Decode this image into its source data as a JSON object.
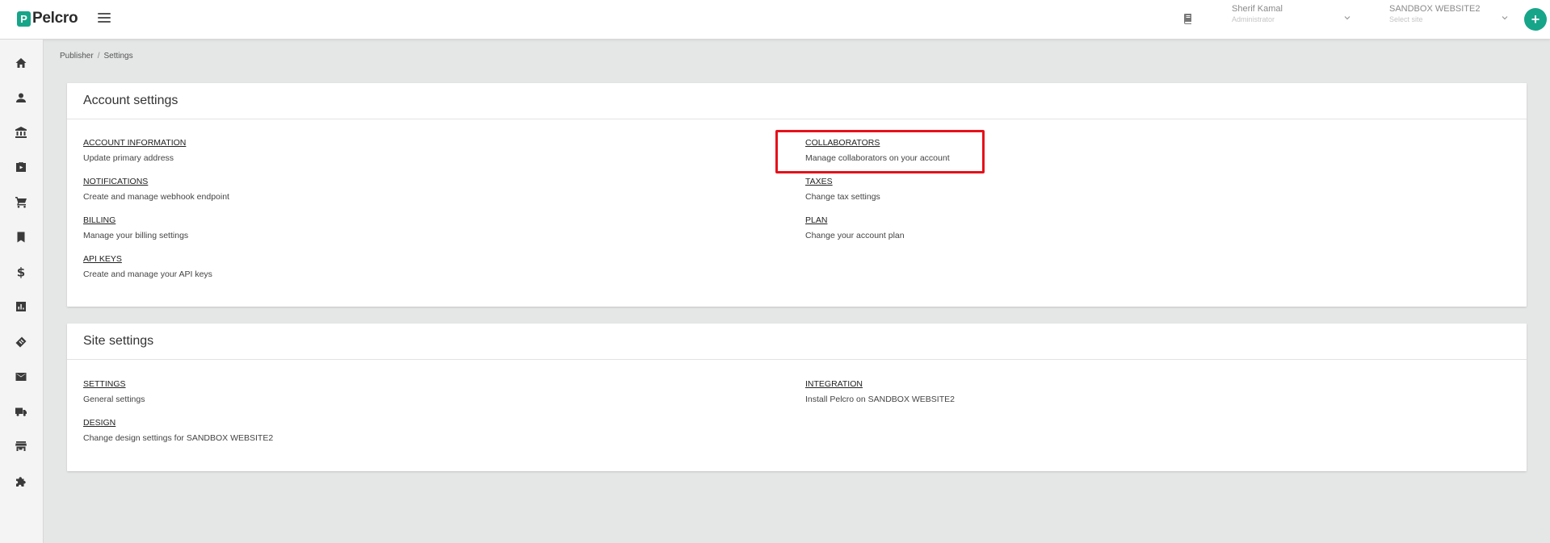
{
  "app": {
    "logo_text": "Pelcro",
    "logo_mark": "P"
  },
  "header": {
    "user_name": "Sherif Kamal",
    "user_role": "Administrator",
    "site_name": "SANDBOX WEBSITE2",
    "site_placeholder": "Select site",
    "add_label": "+"
  },
  "sidebar": {
    "items": [
      {
        "name": "home",
        "icon": "home-icon"
      },
      {
        "name": "customers",
        "icon": "person-icon"
      },
      {
        "name": "bank",
        "icon": "bank-icon"
      },
      {
        "name": "products",
        "icon": "briefcase-icon"
      },
      {
        "name": "orders",
        "icon": "cart-icon"
      },
      {
        "name": "bookmarks",
        "icon": "bookmark-icon"
      },
      {
        "name": "billing",
        "icon": "dollar-icon"
      },
      {
        "name": "reports",
        "icon": "chart-icon"
      },
      {
        "name": "coupons",
        "icon": "ticket-icon"
      },
      {
        "name": "mail",
        "icon": "mail-icon"
      },
      {
        "name": "shipping",
        "icon": "truck-icon"
      },
      {
        "name": "store",
        "icon": "store-icon"
      },
      {
        "name": "integrations",
        "icon": "puzzle-icon"
      }
    ]
  },
  "breadcrumb": {
    "root": "Publisher",
    "separator": "/",
    "current": "Settings"
  },
  "account_settings": {
    "title": "Account settings",
    "items": [
      {
        "label": "ACCOUNT INFORMATION",
        "desc": "Update primary address"
      },
      {
        "label": "COLLABORATORS",
        "desc": "Manage collaborators on your account"
      },
      {
        "label": "NOTIFICATIONS",
        "desc": "Create and manage webhook endpoint"
      },
      {
        "label": "TAXES",
        "desc": "Change tax settings"
      },
      {
        "label": "BILLING",
        "desc": "Manage your billing settings"
      },
      {
        "label": "PLAN",
        "desc": "Change your account plan"
      },
      {
        "label": "API KEYS",
        "desc": "Create and manage your API keys"
      }
    ]
  },
  "site_settings": {
    "title": "Site settings",
    "items": [
      {
        "label": "SETTINGS",
        "desc": "General settings"
      },
      {
        "label": "INTEGRATION",
        "desc": "Install Pelcro on SANDBOX WEBSITE2"
      },
      {
        "label": "DESIGN",
        "desc": "Change design settings for SANDBOX WEBSITE2"
      }
    ]
  },
  "colors": {
    "brand": "#17a589",
    "highlight": "#e6111a"
  }
}
